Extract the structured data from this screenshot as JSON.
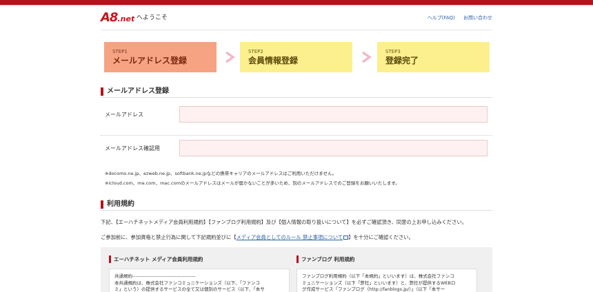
{
  "header": {
    "logo_main": "A8",
    "logo_suffix": ".net",
    "welcome": "へようこそ",
    "links": [
      "ヘルプ(FAQ)",
      "お問い合わせ"
    ]
  },
  "steps": [
    {
      "num": "STEP1",
      "label": "メールアドレス登録",
      "active": true
    },
    {
      "num": "STEP2",
      "label": "会員情報登録",
      "active": false
    },
    {
      "num": "STEP3",
      "label": "登録完了",
      "active": false
    }
  ],
  "mail_section": {
    "title": "メールアドレス登録",
    "email_label": "メールアドレス",
    "email_value": "",
    "confirm_label": "メールアドレス確認用",
    "confirm_value": "",
    "notes": [
      "※docomo.ne.jp、ezweb.ne.jp、softbank.ne.jpなどの携帯キャリアのメールアドレスはご利用いただけません。",
      "※icloud.com、me.com、mac.comのメールアドレスはメールが届かないことが多いため、別のメールアドレスでのご登録をお願いいたします。"
    ]
  },
  "terms_section": {
    "title": "利用規約",
    "intro1": "下記、【エーハチネットメディア会員利用規約】【ファンブログ利用規約】及び【個人情報の取り扱いについて】を必ずご確認頂き、同意の上お申し込みください。",
    "intro2_prefix": "ご参加前に、参加資格と禁止行為に関して下記規約並びに【",
    "intro2_link": "メディア会員としてのルール 禁止事項について",
    "intro2_suffix": "】を十分にご確認ください。",
    "box1": {
      "title": "エーハチネット メディア会員利用規約",
      "lines": [
        "共通規約---------------------------------------",
        "本共通規約は、株式会社ファンコミュニケーションズ（以下、「ファンコ",
        "ミ」という）の提供するサービスの全て又は個別のサービス（以下、「本サ"
      ]
    },
    "box2": {
      "title": "ファンブログ 利用規約",
      "lines": [
        "ファンブログ利用規約（以下「本規約」といいます）は、株式会社ファンコ",
        "ミュニケーションズ（以下「弊社」といいます）と、弊社が提供するWEBロ",
        "グ作成サービス「ファンブログ（http://fanblogs.jp/）」（以下「本サー"
      ]
    }
  },
  "colors": {
    "brand_red": "#b5121b",
    "step_active": "#f6a383",
    "step_inactive": "#fcef8e",
    "input_bg": "#fff1f1",
    "link_blue": "#2a5ea8"
  }
}
